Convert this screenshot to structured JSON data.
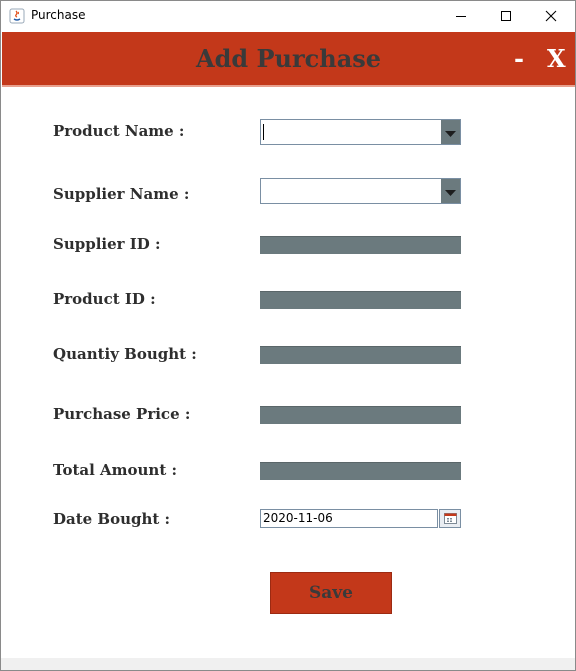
{
  "window": {
    "title": "Purchase"
  },
  "header": {
    "title": "Add Purchase",
    "minimize_label": "-",
    "close_label": "X",
    "accent_color": "#c3381a"
  },
  "form": {
    "product_name_label": "Product Name :",
    "product_name_value": "",
    "supplier_name_label": "Supplier Name :",
    "supplier_name_value": "",
    "supplier_id_label": "Supplier ID :",
    "product_id_label": "Product ID :",
    "quantity_bought_label": "Quantiy Bought :",
    "purchase_price_label": "Purchase Price :",
    "total_amount_label": "Total Amount :",
    "date_bought_label": "Date Bought :",
    "date_bought_value": "2020-11-06",
    "field_fill_color": "#6b7a7e"
  },
  "actions": {
    "save_label": "Save"
  },
  "icons": {
    "app": "java-icon",
    "minimize": "minimize-icon",
    "maximize": "maximize-icon",
    "close": "close-icon",
    "dropdown": "chevron-down-icon",
    "calendar": "calendar-icon"
  }
}
